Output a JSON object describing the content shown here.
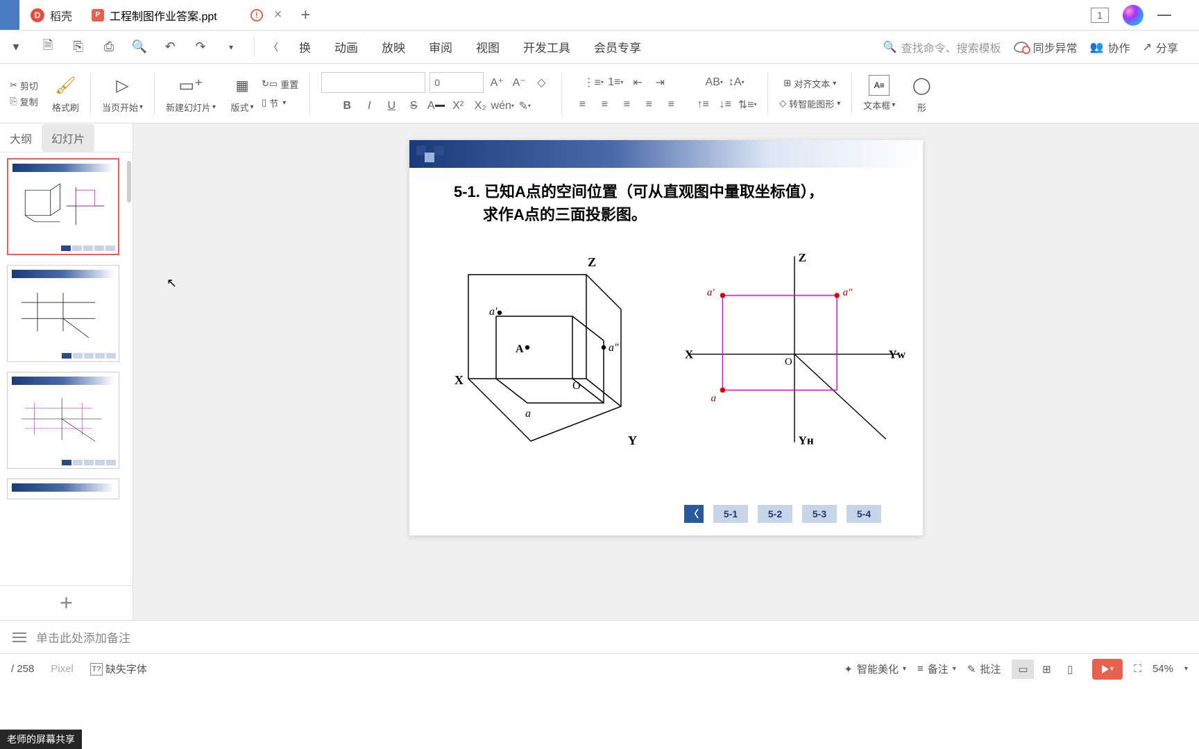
{
  "titlebar": {
    "docer_tab": "稻壳",
    "file_name": "工程制图作业答案.ppt",
    "tab_count": "1"
  },
  "menubar": {
    "tabs": [
      "换",
      "动画",
      "放映",
      "审阅",
      "视图",
      "开发工具",
      "会员专享"
    ],
    "search_placeholder": "查找命令、搜索模板",
    "sync_status": "同步异常",
    "collab": "协作",
    "share": "分享"
  },
  "ribbon": {
    "cut": "剪切",
    "copy": "复制",
    "format_painter": "格式刷",
    "page_start": "当页开始",
    "new_slide": "新建幻灯片",
    "layout": "版式",
    "reset": "重置",
    "segment": "节",
    "font_size": "0",
    "align_text": "对齐文本",
    "convert_smart": "转智能图形",
    "text_box": "文本框",
    "shape": "形"
  },
  "slide_panel": {
    "tab_outline": "大纲",
    "tab_slides": "幻灯片"
  },
  "slide": {
    "title_line1": "5-1. 已知A点的空间位置（可从直观图中量取坐标值），",
    "title_line2": "求作A点的三面投影图。",
    "labels": {
      "Z": "Z",
      "X": "X",
      "Y": "Y",
      "O": "O",
      "A": "A",
      "a": "a",
      "a_prime": "a′",
      "a_dprime": "a″",
      "Yw": "Yᴡ",
      "Yh": "Yн"
    },
    "nav": [
      "5-1",
      "5-2",
      "5-3",
      "5-4"
    ]
  },
  "notes": {
    "placeholder": "单击此处添加备注"
  },
  "statusbar": {
    "page_info": "/ 258",
    "ppi": "Pixel",
    "missing_font": "缺失字体",
    "smart_beautify": "智能美化",
    "notes_label": "备注",
    "comments_label": "批注",
    "zoom": "54%"
  },
  "overlay": {
    "screen_share": "老师的屏幕共享"
  }
}
